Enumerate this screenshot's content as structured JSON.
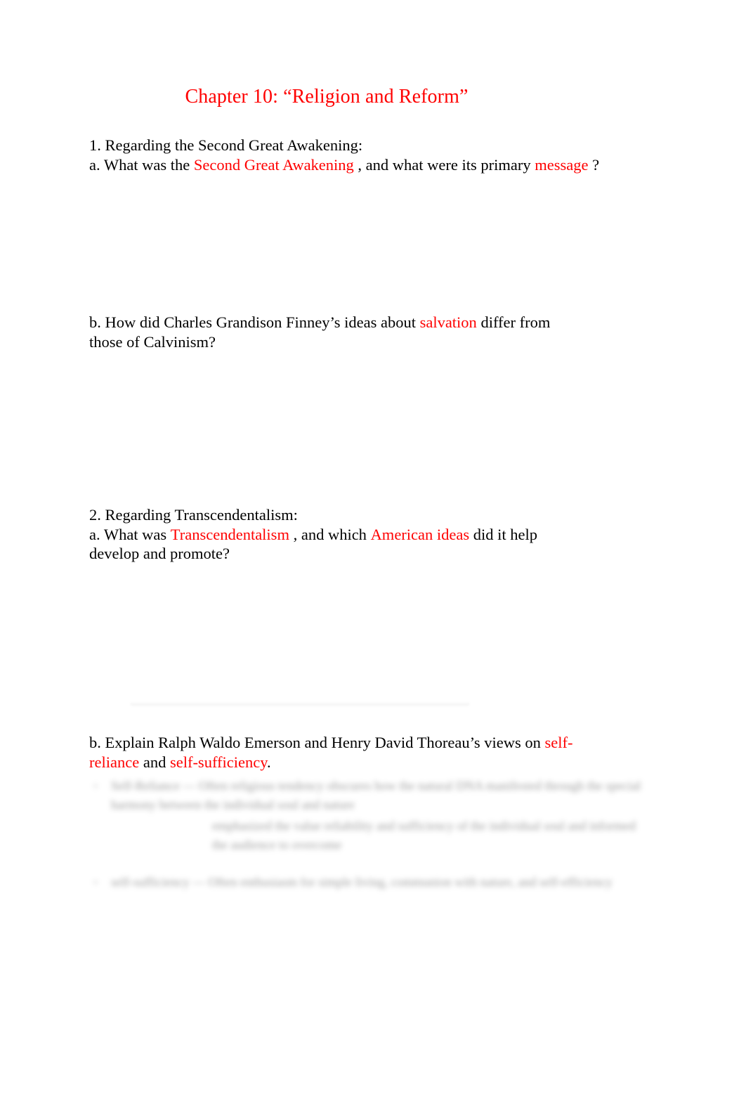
{
  "document": {
    "title": "Chapter 10: “Religion and Reform”",
    "accent_color": "#ff0000",
    "text_color": "#000000",
    "background_color": "#ffffff"
  },
  "questions": [
    {
      "number": "1. Regarding the Second Great Awakening:",
      "sub_label": "a. What was the",
      "part_a": {
        "pre": "a. What was the",
        "keyword1": "Second Great Awakening",
        "mid": ", and what were its primary",
        "keyword2": "message",
        "post": "?"
      },
      "part_b": {
        "pre": "b. How did Charles Grandison Finney’s ideas about",
        "keyword1": "salvation",
        "post": "differ from those of Calvinism?"
      }
    },
    {
      "number": "2. Regarding Transcendentalism:",
      "part_a": {
        "pre": "a. What was",
        "keyword1": "Transcendentalism",
        "mid": ", and which",
        "keyword2": "American ideas",
        "post": "did it help develop and promote?"
      },
      "part_b": {
        "pre": "b. Explain Ralph Waldo Emerson and Henry David Thoreau’s views on",
        "keyword1": "self-reliance",
        "mid": "and",
        "keyword2": "self-sufficiency",
        "post": "."
      }
    }
  ],
  "redacted": {
    "note": "blurred illegible handwritten/typed answer notes",
    "bullets": [
      {
        "marker": "◦",
        "level": 1,
        "text": "Self-Reliance — Often religious tendency obscures how the natural DNA manifested through the special harmony between the individual soul and nature"
      },
      {
        "marker": "",
        "level": 2,
        "text": "emphasized the value reliability and sufficiency of the individual soul and informed the audience to overcome"
      },
      {
        "marker": "◦",
        "level": 1,
        "text": "self-sufficiency — Often enthusiasm for simple living, communion with nature, and self-efficiency"
      }
    ]
  }
}
